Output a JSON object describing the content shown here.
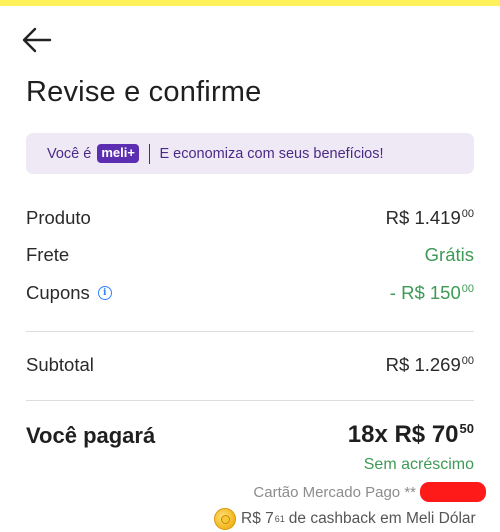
{
  "header": {
    "title": "Revise e confirme",
    "back_icon": "arrow-left-icon"
  },
  "banner": {
    "prefix": "Você é",
    "badge": "meli+",
    "text": "E economiza com seus benefícios!"
  },
  "summary": {
    "product_label": "Produto",
    "product_value": "R$ 1.419",
    "product_cents": "00",
    "shipping_label": "Frete",
    "shipping_value": "Grátis",
    "coupons_label": "Cupons",
    "coupons_value": "- R$ 150",
    "coupons_cents": "00",
    "subtotal_label": "Subtotal",
    "subtotal_value": "R$ 1.269",
    "subtotal_cents": "00"
  },
  "payment": {
    "label": "Você pagará",
    "value": "18x R$ 70",
    "cents": "50",
    "no_fee": "Sem acréscimo",
    "card": "Cartão Mercado Pago **",
    "cashback_amount": "R$ 7",
    "cashback_cents": "61",
    "cashback_text": "de cashback em Meli Dólar"
  },
  "colors": {
    "accent_purple": "#5c2eb1",
    "green": "#3e9a56",
    "info_blue": "#3483fa",
    "top_strip": "#fff159"
  }
}
